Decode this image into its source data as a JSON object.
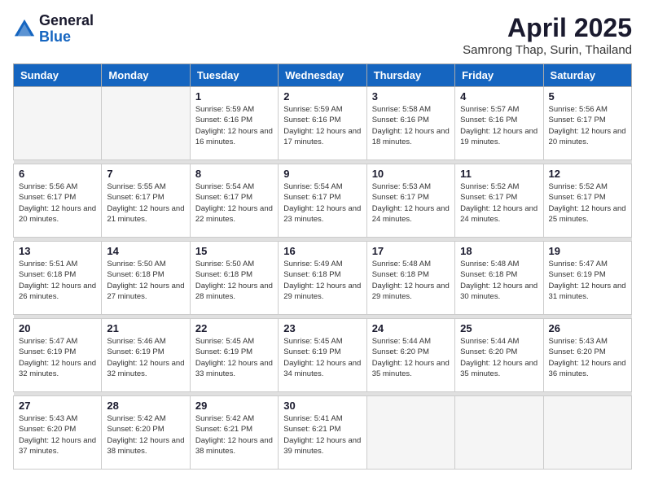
{
  "header": {
    "logo_general": "General",
    "logo_blue": "Blue",
    "title": "April 2025",
    "subtitle": "Samrong Thap, Surin, Thailand"
  },
  "weekdays": [
    "Sunday",
    "Monday",
    "Tuesday",
    "Wednesday",
    "Thursday",
    "Friday",
    "Saturday"
  ],
  "weeks": [
    [
      {
        "day": "",
        "info": ""
      },
      {
        "day": "",
        "info": ""
      },
      {
        "day": "1",
        "info": "Sunrise: 5:59 AM\nSunset: 6:16 PM\nDaylight: 12 hours and 16 minutes."
      },
      {
        "day": "2",
        "info": "Sunrise: 5:59 AM\nSunset: 6:16 PM\nDaylight: 12 hours and 17 minutes."
      },
      {
        "day": "3",
        "info": "Sunrise: 5:58 AM\nSunset: 6:16 PM\nDaylight: 12 hours and 18 minutes."
      },
      {
        "day": "4",
        "info": "Sunrise: 5:57 AM\nSunset: 6:16 PM\nDaylight: 12 hours and 19 minutes."
      },
      {
        "day": "5",
        "info": "Sunrise: 5:56 AM\nSunset: 6:17 PM\nDaylight: 12 hours and 20 minutes."
      }
    ],
    [
      {
        "day": "6",
        "info": "Sunrise: 5:56 AM\nSunset: 6:17 PM\nDaylight: 12 hours and 20 minutes."
      },
      {
        "day": "7",
        "info": "Sunrise: 5:55 AM\nSunset: 6:17 PM\nDaylight: 12 hours and 21 minutes."
      },
      {
        "day": "8",
        "info": "Sunrise: 5:54 AM\nSunset: 6:17 PM\nDaylight: 12 hours and 22 minutes."
      },
      {
        "day": "9",
        "info": "Sunrise: 5:54 AM\nSunset: 6:17 PM\nDaylight: 12 hours and 23 minutes."
      },
      {
        "day": "10",
        "info": "Sunrise: 5:53 AM\nSunset: 6:17 PM\nDaylight: 12 hours and 24 minutes."
      },
      {
        "day": "11",
        "info": "Sunrise: 5:52 AM\nSunset: 6:17 PM\nDaylight: 12 hours and 24 minutes."
      },
      {
        "day": "12",
        "info": "Sunrise: 5:52 AM\nSunset: 6:17 PM\nDaylight: 12 hours and 25 minutes."
      }
    ],
    [
      {
        "day": "13",
        "info": "Sunrise: 5:51 AM\nSunset: 6:18 PM\nDaylight: 12 hours and 26 minutes."
      },
      {
        "day": "14",
        "info": "Sunrise: 5:50 AM\nSunset: 6:18 PM\nDaylight: 12 hours and 27 minutes."
      },
      {
        "day": "15",
        "info": "Sunrise: 5:50 AM\nSunset: 6:18 PM\nDaylight: 12 hours and 28 minutes."
      },
      {
        "day": "16",
        "info": "Sunrise: 5:49 AM\nSunset: 6:18 PM\nDaylight: 12 hours and 29 minutes."
      },
      {
        "day": "17",
        "info": "Sunrise: 5:48 AM\nSunset: 6:18 PM\nDaylight: 12 hours and 29 minutes."
      },
      {
        "day": "18",
        "info": "Sunrise: 5:48 AM\nSunset: 6:18 PM\nDaylight: 12 hours and 30 minutes."
      },
      {
        "day": "19",
        "info": "Sunrise: 5:47 AM\nSunset: 6:19 PM\nDaylight: 12 hours and 31 minutes."
      }
    ],
    [
      {
        "day": "20",
        "info": "Sunrise: 5:47 AM\nSunset: 6:19 PM\nDaylight: 12 hours and 32 minutes."
      },
      {
        "day": "21",
        "info": "Sunrise: 5:46 AM\nSunset: 6:19 PM\nDaylight: 12 hours and 32 minutes."
      },
      {
        "day": "22",
        "info": "Sunrise: 5:45 AM\nSunset: 6:19 PM\nDaylight: 12 hours and 33 minutes."
      },
      {
        "day": "23",
        "info": "Sunrise: 5:45 AM\nSunset: 6:19 PM\nDaylight: 12 hours and 34 minutes."
      },
      {
        "day": "24",
        "info": "Sunrise: 5:44 AM\nSunset: 6:20 PM\nDaylight: 12 hours and 35 minutes."
      },
      {
        "day": "25",
        "info": "Sunrise: 5:44 AM\nSunset: 6:20 PM\nDaylight: 12 hours and 35 minutes."
      },
      {
        "day": "26",
        "info": "Sunrise: 5:43 AM\nSunset: 6:20 PM\nDaylight: 12 hours and 36 minutes."
      }
    ],
    [
      {
        "day": "27",
        "info": "Sunrise: 5:43 AM\nSunset: 6:20 PM\nDaylight: 12 hours and 37 minutes."
      },
      {
        "day": "28",
        "info": "Sunrise: 5:42 AM\nSunset: 6:20 PM\nDaylight: 12 hours and 38 minutes."
      },
      {
        "day": "29",
        "info": "Sunrise: 5:42 AM\nSunset: 6:21 PM\nDaylight: 12 hours and 38 minutes."
      },
      {
        "day": "30",
        "info": "Sunrise: 5:41 AM\nSunset: 6:21 PM\nDaylight: 12 hours and 39 minutes."
      },
      {
        "day": "",
        "info": ""
      },
      {
        "day": "",
        "info": ""
      },
      {
        "day": "",
        "info": ""
      }
    ]
  ]
}
